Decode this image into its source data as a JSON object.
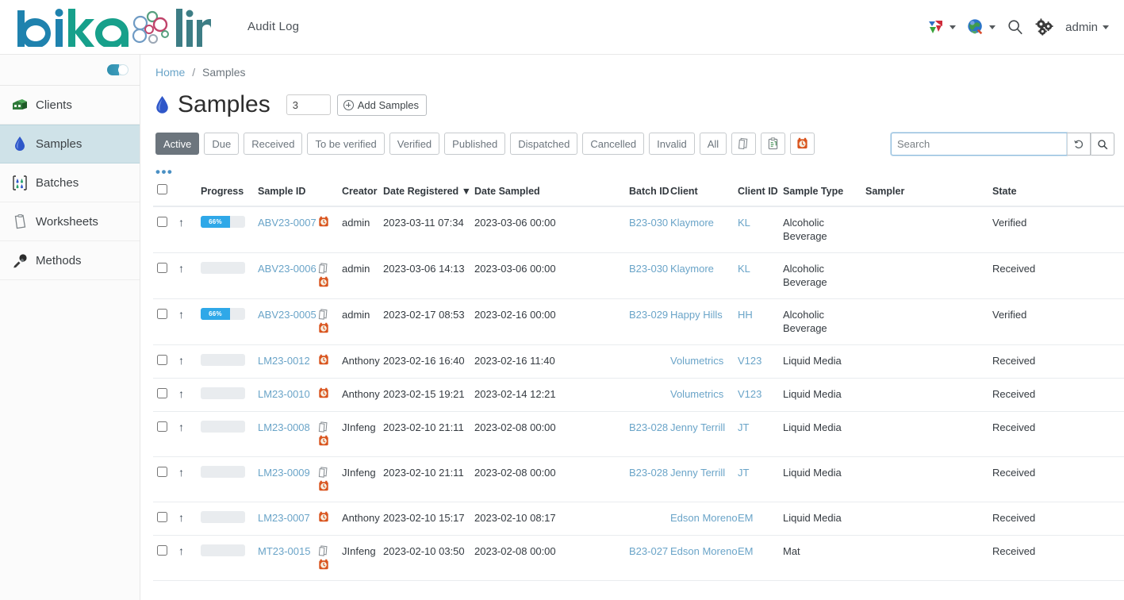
{
  "header": {
    "brand_primary": "bika",
    "brand_secondary": "lims",
    "audit_log_label": "Audit Log",
    "user_label": "admin",
    "icons": [
      "sync-arrows-icon",
      "globe-icon",
      "search-icon",
      "gears-icon"
    ],
    "colors": {
      "brand_blue": "#1a7fa8",
      "brand_teal": "#17a08b",
      "link": "#6aa4c8"
    }
  },
  "sidebar": {
    "toggle_name": "sidebar-collapse-toggle",
    "items": [
      {
        "label": "Clients",
        "icon": "clients-icon",
        "active": false
      },
      {
        "label": "Samples",
        "icon": "droplet-icon",
        "active": true
      },
      {
        "label": "Batches",
        "icon": "batches-icon",
        "active": false
      },
      {
        "label": "Worksheets",
        "icon": "worksheet-icon",
        "active": false
      },
      {
        "label": "Methods",
        "icon": "pipette-icon",
        "active": false
      }
    ]
  },
  "breadcrumb": {
    "home": "Home",
    "separator": "/",
    "current": "Samples"
  },
  "page": {
    "title": "Samples",
    "title_icon": "droplet-icon",
    "count_value": "3",
    "add_button_label": "Add Samples"
  },
  "filters": {
    "buttons": [
      {
        "label": "Active",
        "active": true
      },
      {
        "label": "Due",
        "active": false
      },
      {
        "label": "Received",
        "active": false
      },
      {
        "label": "To be verified",
        "active": false
      },
      {
        "label": "Verified",
        "active": false
      },
      {
        "label": "Published",
        "active": false
      },
      {
        "label": "Dispatched",
        "active": false
      },
      {
        "label": "Cancelled",
        "active": false
      },
      {
        "label": "Invalid",
        "active": false
      },
      {
        "label": "All",
        "active": false
      }
    ],
    "icon_buttons": [
      "print-copy-icon",
      "clipboard-icon",
      "late-clock-icon"
    ]
  },
  "search": {
    "placeholder": "Search",
    "value": "",
    "reset_icon": "undo-icon",
    "submit_icon": "search-icon"
  },
  "toolbar": {
    "more_columns_label": "•••"
  },
  "table": {
    "columns": [
      {
        "key": "select",
        "label": ""
      },
      {
        "key": "priority",
        "label": ""
      },
      {
        "key": "progress",
        "label": "Progress"
      },
      {
        "key": "sample_id",
        "label": "Sample ID"
      },
      {
        "key": "creator",
        "label": "Creator"
      },
      {
        "key": "date_registered",
        "label": "Date Registered",
        "sorted": "desc",
        "sort_glyph": "▼"
      },
      {
        "key": "date_sampled",
        "label": "Date Sampled"
      },
      {
        "key": "batch_id",
        "label": "Batch ID"
      },
      {
        "key": "client",
        "label": "Client"
      },
      {
        "key": "client_id",
        "label": "Client ID"
      },
      {
        "key": "sample_type",
        "label": "Sample Type"
      },
      {
        "key": "sampler",
        "label": "Sampler"
      },
      {
        "key": "state",
        "label": "State"
      }
    ],
    "rows": [
      {
        "sample_id": "ABV23-0007",
        "progress": 66,
        "progress_label": "66%",
        "icons": [
          "late-clock-icon"
        ],
        "creator": "admin",
        "date_registered": "2023-03-11 07:34",
        "date_sampled": "2023-03-06 00:00",
        "batch_id": "B23-030",
        "client": "Klaymore",
        "client_id": "KL",
        "sample_type": "Alcoholic Beverage",
        "sampler": "",
        "state": "Verified"
      },
      {
        "sample_id": "ABV23-0006",
        "progress": 0,
        "progress_label": "",
        "icons": [
          "partition-icon",
          "late-clock-icon"
        ],
        "creator": "admin",
        "date_registered": "2023-03-06 14:13",
        "date_sampled": "2023-03-06 00:00",
        "batch_id": "B23-030",
        "client": "Klaymore",
        "client_id": "KL",
        "sample_type": "Alcoholic Beverage",
        "sampler": "",
        "state": "Received"
      },
      {
        "sample_id": "ABV23-0005",
        "progress": 66,
        "progress_label": "66%",
        "icons": [
          "partition-icon",
          "late-clock-icon"
        ],
        "creator": "admin",
        "date_registered": "2023-02-17 08:53",
        "date_sampled": "2023-02-16 00:00",
        "batch_id": "B23-029",
        "client": "Happy Hills",
        "client_id": "HH",
        "sample_type": "Alcoholic Beverage",
        "sampler": "",
        "state": "Verified"
      },
      {
        "sample_id": "LM23-0012",
        "progress": 0,
        "progress_label": "",
        "icons": [
          "late-clock-icon"
        ],
        "creator": "Anthony",
        "date_registered": "2023-02-16 16:40",
        "date_sampled": "2023-02-16 11:40",
        "batch_id": "",
        "client": "Volumetrics",
        "client_id": "V123",
        "sample_type": "Liquid Media",
        "sampler": "",
        "state": "Received"
      },
      {
        "sample_id": "LM23-0010",
        "progress": 0,
        "progress_label": "",
        "icons": [
          "late-clock-icon"
        ],
        "creator": "Anthony",
        "date_registered": "2023-02-15 19:21",
        "date_sampled": "2023-02-14 12:21",
        "batch_id": "",
        "client": "Volumetrics",
        "client_id": "V123",
        "sample_type": "Liquid Media",
        "sampler": "",
        "state": "Received"
      },
      {
        "sample_id": "LM23-0008",
        "progress": 0,
        "progress_label": "",
        "icons": [
          "partition-icon",
          "late-clock-icon"
        ],
        "creator": "JInfeng",
        "date_registered": "2023-02-10 21:11",
        "date_sampled": "2023-02-08 00:00",
        "batch_id": "B23-028",
        "client": "Jenny Terrill",
        "client_id": "JT",
        "sample_type": "Liquid Media",
        "sampler": "",
        "state": "Received"
      },
      {
        "sample_id": "LM23-0009",
        "progress": 0,
        "progress_label": "",
        "icons": [
          "partition-icon",
          "late-clock-icon"
        ],
        "creator": "JInfeng",
        "date_registered": "2023-02-10 21:11",
        "date_sampled": "2023-02-08 00:00",
        "batch_id": "B23-028",
        "client": "Jenny Terrill",
        "client_id": "JT",
        "sample_type": "Liquid Media",
        "sampler": "",
        "state": "Received"
      },
      {
        "sample_id": "LM23-0007",
        "progress": 0,
        "progress_label": "",
        "icons": [
          "late-clock-icon"
        ],
        "creator": "Anthony",
        "date_registered": "2023-02-10 15:17",
        "date_sampled": "2023-02-10 08:17",
        "batch_id": "",
        "client": "Edson Moreno",
        "client_id": "EM",
        "sample_type": "Liquid Media",
        "sampler": "",
        "state": "Received"
      },
      {
        "sample_id": "MT23-0015",
        "progress": 0,
        "progress_label": "",
        "icons": [
          "partition-icon",
          "late-clock-icon"
        ],
        "creator": "JInfeng",
        "date_registered": "2023-02-10 03:50",
        "date_sampled": "2023-02-08 00:00",
        "batch_id": "B23-027",
        "client": "Edson Moreno",
        "client_id": "EM",
        "sample_type": "Mat",
        "sampler": "",
        "state": "Received"
      }
    ]
  }
}
